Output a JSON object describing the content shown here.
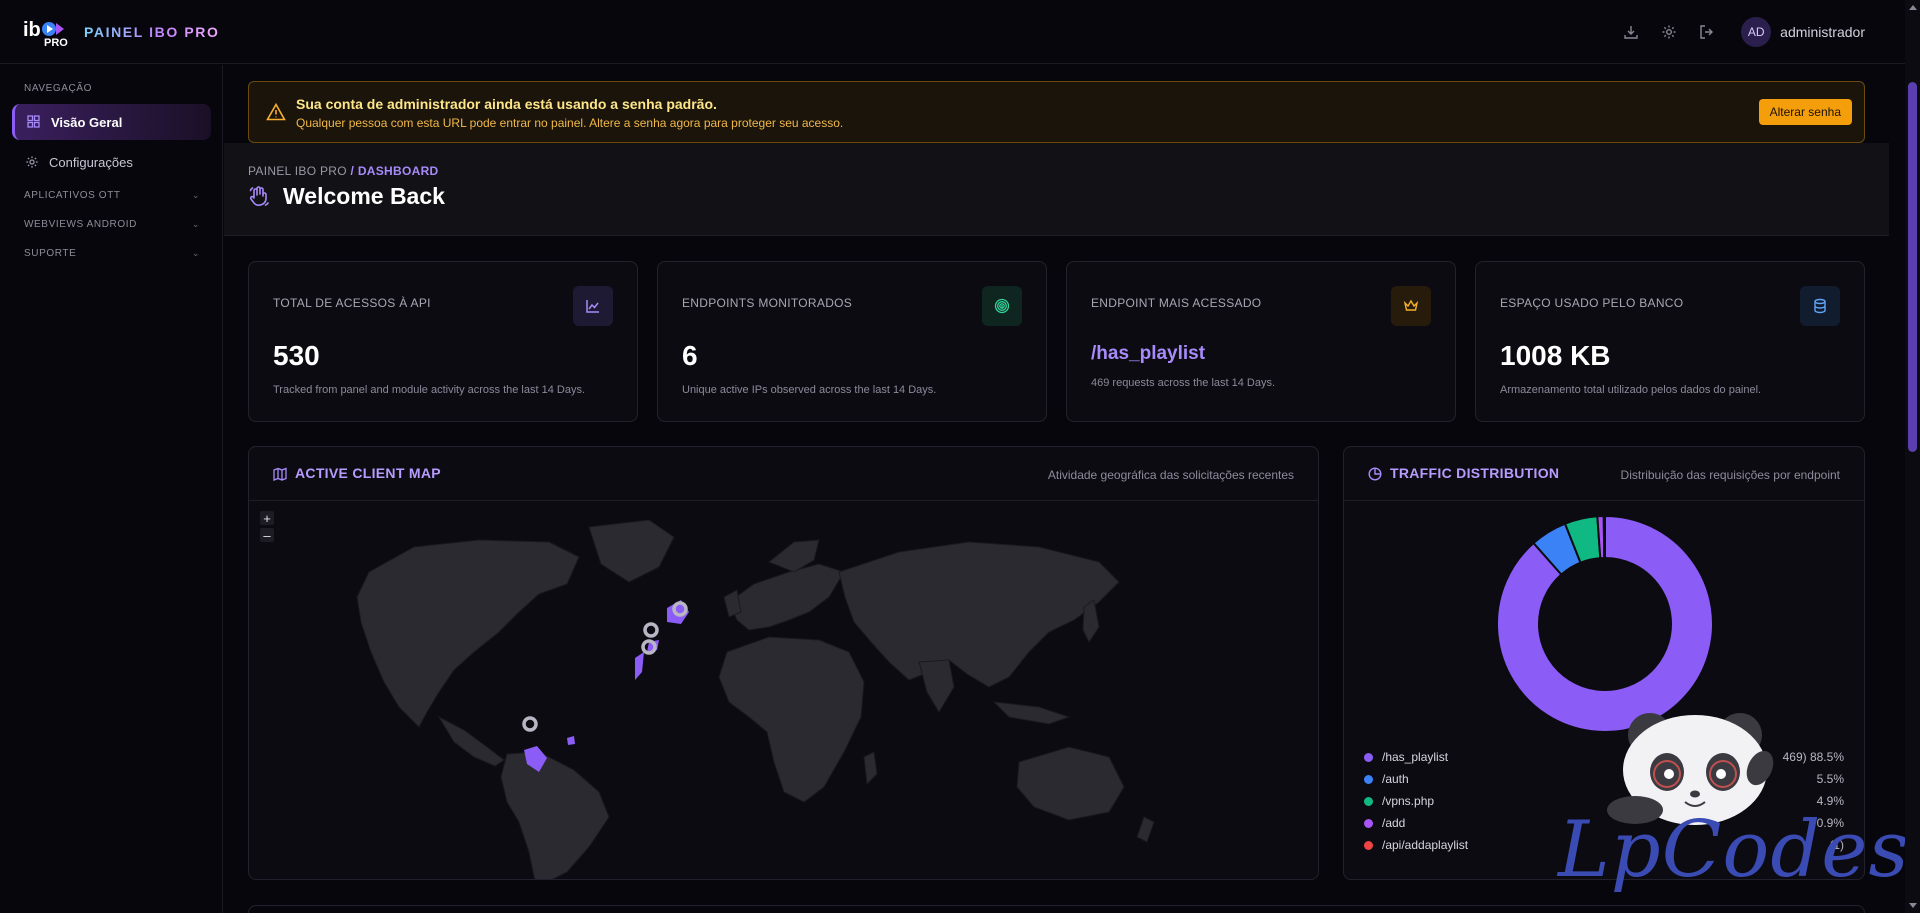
{
  "header": {
    "brand": "PAINEL IBO PRO",
    "logo_text": "ibo PRO",
    "icons": [
      "download-icon",
      "gear-icon",
      "logout-icon"
    ],
    "avatar_initials": "AD",
    "username": "administrador"
  },
  "sidebar": {
    "heading": "NAVEGAÇÃO",
    "items": [
      {
        "label": "Visão Geral",
        "icon": "grid-icon",
        "active": true
      },
      {
        "label": "Configurações",
        "icon": "gear-icon",
        "active": false
      }
    ],
    "groups": [
      {
        "label": "APLICATIVOS OTT"
      },
      {
        "label": "WEBVIEWS ANDROID"
      },
      {
        "label": "SUPORTE"
      }
    ]
  },
  "alert": {
    "title": "Sua conta de administrador ainda está usando a senha padrão.",
    "message": "Qualquer pessoa com esta URL pode entrar no painel. Altere a senha agora para proteger seu acesso.",
    "button": "Alterar senha"
  },
  "page": {
    "breadcrumb_root": "PAINEL IBO PRO",
    "breadcrumb_current": "/ DASHBOARD",
    "title": "Welcome Back"
  },
  "stats": [
    {
      "label": "TOTAL DE ACESSOS À API",
      "value": "530",
      "note": "Tracked from panel and module activity across the last 14 Days.",
      "icon": "trend-icon",
      "accent": "#a78bfa"
    },
    {
      "label": "ENDPOINTS MONITORADOS",
      "value": "6",
      "note": "Unique active IPs observed across the last 14 Days.",
      "icon": "fingerprint-icon",
      "accent": "#34d399"
    },
    {
      "label": "ENDPOINT MAIS ACESSADO",
      "value": "/has_playlist",
      "note": "469 requests across the last 14 Days.",
      "icon": "crown-icon",
      "accent": "#f5b02e"
    },
    {
      "label": "ESPAÇO USADO PELO BANCO",
      "value": "1008 KB",
      "note": "Armazenamento total utilizado pelos dados do painel.",
      "icon": "database-icon",
      "accent": "#60a5fa"
    }
  ],
  "map_panel": {
    "title": "ACTIVE CLIENT MAP",
    "subtitle": "Atividade geográfica das solicitações recentes",
    "zoom_in": "+",
    "zoom_out": "–"
  },
  "traffic_panel": {
    "title": "TRAFFIC DISTRIBUTION",
    "subtitle": "Distribuição das requisições por endpoint"
  },
  "chart_data": {
    "type": "pie",
    "donut": true,
    "categories": [
      "/has_playlist",
      "/auth",
      "/vpns.php",
      "/add",
      "/api/addaplaylist"
    ],
    "series": [
      {
        "values": [
          469,
          29,
          26,
          5,
          1
        ],
        "percent_labels": [
          "469)",
          "5.5%",
          "4.9%",
          "0.9%",
          "(1)"
        ],
        "shares": [
          "88.5%",
          "5.5%",
          "4.9%",
          "0.9%",
          "0.2%"
        ]
      }
    ],
    "colors": [
      "#8b5cf6",
      "#3b82f6",
      "#10b981",
      "#a855f7",
      "#ef4444"
    ],
    "legend_placement": "bottom"
  },
  "legend_display": [
    {
      "label": "/has_playlist",
      "value": "469)  88.5%"
    },
    {
      "label": "/auth",
      "value": "5.5%"
    },
    {
      "label": "/vpns.php",
      "value": "4.9%"
    },
    {
      "label": "/add",
      "value": "0.9%"
    },
    {
      "label": "/api/addaplaylist",
      "value": "(1)"
    }
  ],
  "watermark": {
    "text": "LpCodes"
  }
}
